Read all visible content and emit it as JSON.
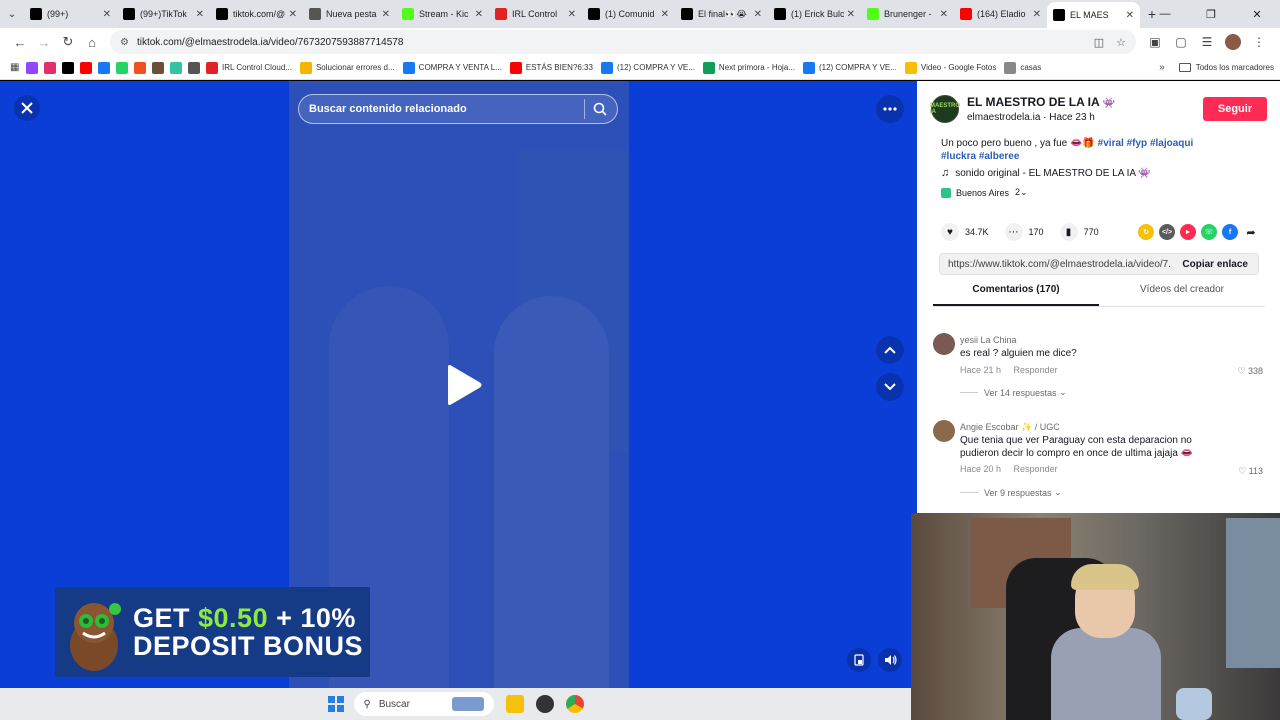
{
  "browser": {
    "tabs": [
      {
        "title": "(99+)",
        "icon": "tiktok",
        "color": "#000000",
        "active": false
      },
      {
        "title": "(99+)TikTok",
        "icon": "tiktok",
        "color": "#000000",
        "active": false
      },
      {
        "title": "tiktok.com/@",
        "icon": "tiktok",
        "color": "#000000",
        "active": false
      },
      {
        "title": "Nueva pesta",
        "icon": "chrome",
        "color": "#555555",
        "active": false
      },
      {
        "title": "Stream - Kic",
        "icon": "kick",
        "color": "#53fc18",
        "active": false
      },
      {
        "title": "IRL Control",
        "icon": "irl",
        "color": "#e02424",
        "active": false
      },
      {
        "title": "(1) Comunid",
        "icon": "x",
        "color": "#000000",
        "active": false
      },
      {
        "title": "El final👀😭",
        "icon": "tiktok",
        "color": "#000000",
        "active": false
      },
      {
        "title": "(1) Erick Bulc",
        "icon": "x",
        "color": "#000000",
        "active": false
      },
      {
        "title": "Brunenger -",
        "icon": "kick",
        "color": "#53fc18",
        "active": false
      },
      {
        "title": "(164) Eladio",
        "icon": "youtube",
        "color": "#ff0000",
        "active": false
      },
      {
        "title": "EL MAES",
        "icon": "tiktok",
        "color": "#000000",
        "active": true
      }
    ],
    "url": "tiktok.com/@elmaestrodela.ia/video/7673207593887714578",
    "bookmarks": [
      {
        "label": "",
        "color": "#9146ff"
      },
      {
        "label": "",
        "color": "#e1306c"
      },
      {
        "label": "",
        "color": "#000000"
      },
      {
        "label": "",
        "color": "#ff0000"
      },
      {
        "label": "",
        "color": "#1877f2"
      },
      {
        "label": "",
        "color": "#25d366"
      },
      {
        "label": "",
        "color": "#f25022"
      },
      {
        "label": "",
        "color": "#6b4f3a"
      },
      {
        "label": "",
        "color": "#34c2a0"
      },
      {
        "label": "",
        "color": "#555555"
      },
      {
        "label": "IRL Control Cloud...",
        "color": "#e02424"
      },
      {
        "label": "Solucionar errores d...",
        "color": "#f4b400"
      },
      {
        "label": "COMPRA Y VENTA L...",
        "color": "#1877f2"
      },
      {
        "label": "ESTÁS BIEN?6:33",
        "color": "#ff0000"
      },
      {
        "label": "(12) COMPRA Y VE...",
        "color": "#1877f2"
      },
      {
        "label": "Next primora - Hoja...",
        "color": "#0f9d58"
      },
      {
        "label": "(12) COMPRA Y VE...",
        "color": "#1877f2"
      },
      {
        "label": "Video - Google Fotos",
        "color": "#fbbc04"
      },
      {
        "label": "casas",
        "color": "#888888"
      }
    ],
    "all_bookmarks": "Todos los marcadores"
  },
  "video": {
    "search_placeholder": "Buscar contenido relacionado",
    "bg_color": "#0b3ed6"
  },
  "ad": {
    "line1_a": "GET ",
    "line1_b": "$0.50",
    "line1_c": " + 10%",
    "line2": "DEPOSIT BONUS"
  },
  "post": {
    "author_name": "EL MAESTRO DE LA IA",
    "author_emoji": "👾",
    "author_handle": "elmaestrodela.ia",
    "time_sep": " · ",
    "posted": "Hace 23 h",
    "follow_label": "Seguir",
    "avatar_text": "MAESTRO IA",
    "description": "Un poco pero bueno , ya fue 👄🎁",
    "hashtags": [
      "#viral",
      "#fyp",
      "#lajoaqui",
      "#luckra",
      "#alberee"
    ],
    "sound": "sonido original - EL MAESTRO DE LA IA 👾",
    "location": "Buenos Aires",
    "location_count": "2",
    "likes": "34.7K",
    "comments": "170",
    "saves": "770",
    "share_link": "https://www.tiktok.com/@elmaestrodela.ia/video/7...",
    "copy_label": "Copiar enlace",
    "tab_comments": "Comentarios (170)",
    "tab_creator": "Vídeos del creador"
  },
  "comments": [
    {
      "name": "yesii La China",
      "text": "es real ? alguien me dice?",
      "time": "Hace 21 h",
      "reply": "Responder",
      "likes": "338",
      "replies": "Ver 14 respuestas",
      "avatar_color": "#7a5a52"
    },
    {
      "name": "Angie Escobar ✨ / UGC",
      "text": "Que tenia que ver Paraguay con esta deparacion no pudieron decir lo compro en once de ultima jajaja 👄",
      "time": "Hace 20 h",
      "reply": "Responder",
      "likes": "113",
      "replies": "Ver 9 respuestas",
      "avatar_color": "#8a6a4a"
    }
  ],
  "taskbar": {
    "search_label": "Buscar"
  }
}
